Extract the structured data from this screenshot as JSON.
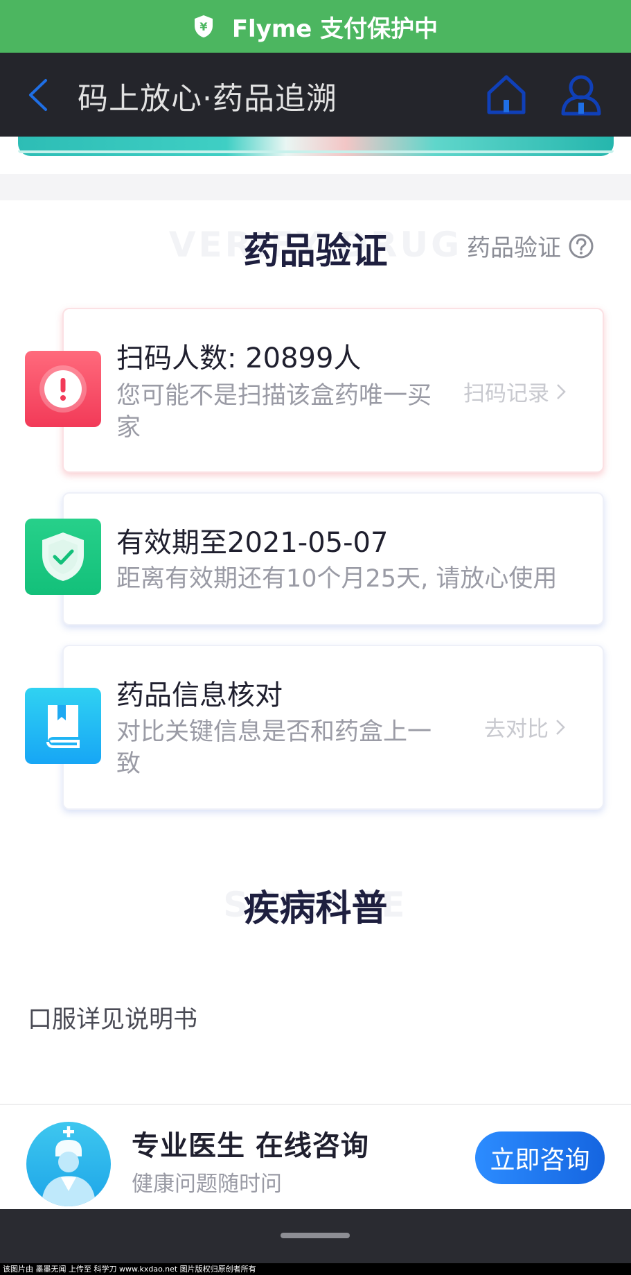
{
  "top_bar": {
    "text": "Flyme 支付保护中",
    "icon": "yuan-shield-icon",
    "color": "#4cb660"
  },
  "nav": {
    "title": "码上放心·药品追溯",
    "back_icon": "back-chevron-icon",
    "home_icon": "home-icon",
    "user_icon": "user-icon"
  },
  "verify_section": {
    "title": "药品验证",
    "bg_text": "VERIFY DRUG",
    "help_link": "药品验证",
    "help_icon": "question-circle-icon"
  },
  "cards": [
    {
      "icon": "alert-circle-icon",
      "title": "扫码人数: 20899人",
      "sub": "您可能不是扫描该盒药唯一买家",
      "link": "扫码记录"
    },
    {
      "icon": "check-shield-icon",
      "title": "有效期至2021-05-07",
      "sub": "距离有效期还有10个月25天, 请放心使用"
    },
    {
      "icon": "book-icon",
      "title": "药品信息核对",
      "sub": "对比关键信息是否和药盒上一致",
      "link": "去对比"
    }
  ],
  "science_section": {
    "title": "疾病科普",
    "bg_text": "SCIENCE"
  },
  "note": "口服详见说明书",
  "consult": {
    "title": "专业医生 在线咨询",
    "subtitle": "健康问题随时问",
    "button": "立即咨询",
    "avatar_icon": "doctor-avatar-icon"
  },
  "watermark": "该图片由 墨墨无闻 上传至 科学刀 www.kxdao.net 图片版权归原创者所有",
  "colors": {
    "accent": "#1565e0",
    "red": "#f23a58",
    "green": "#13c07a",
    "blue": "#17a6f5",
    "nav_bg": "#24252b"
  }
}
